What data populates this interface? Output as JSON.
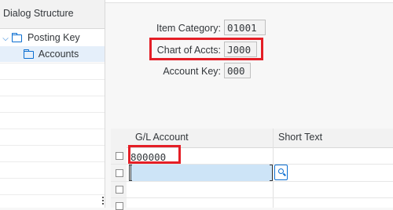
{
  "dialog_structure": {
    "header": "Dialog Structure",
    "nodes": [
      {
        "label": "Posting Key",
        "expanded": true,
        "icon": "folder-open-icon"
      },
      {
        "label": "Accounts",
        "selected": true,
        "icon": "folder-open-icon"
      }
    ]
  },
  "form": {
    "item_category": {
      "label": "Item Category:",
      "value": "01001"
    },
    "chart_of_accts": {
      "label": "Chart of Accts:",
      "value": "J000"
    },
    "account_key": {
      "label": "Account Key:",
      "value": "000"
    }
  },
  "table": {
    "columns": [
      "G/L Account",
      "Short Text"
    ],
    "rows": [
      {
        "gl_account": "800000",
        "short_text": ""
      },
      {
        "gl_account": "",
        "short_text": ""
      },
      {
        "gl_account": "",
        "short_text": ""
      },
      {
        "gl_account": "",
        "short_text": ""
      }
    ]
  },
  "colors": {
    "highlight_red": "#e41e26",
    "selection_blue": "#cde4f7",
    "tree_selected": "#e5effa",
    "accent": "#0a6ed1"
  }
}
